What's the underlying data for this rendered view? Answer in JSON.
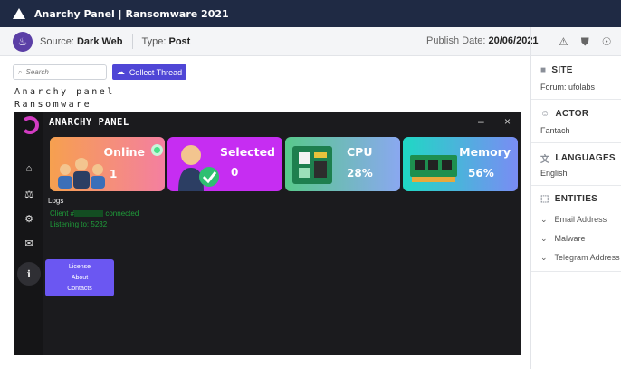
{
  "window": {
    "title": "Anarchy Panel | Ransomware 2021"
  },
  "header": {
    "source_label": "Source:",
    "source_value": "Dark Web",
    "type_label": "Type:",
    "type_value": "Post",
    "publish_label": "Publish Date:",
    "publish_value": "20/06/2021"
  },
  "toolbar": {
    "search_placeholder": "Search",
    "collect_label": "Collect Thread"
  },
  "doc": {
    "line1": "Anarchy panel",
    "line2": "Ransomware"
  },
  "panel": {
    "title": "ANARCHY PANEL",
    "minimize": "–",
    "close": "×",
    "cards": [
      {
        "title": "Online",
        "value": "1"
      },
      {
        "title": "Selected",
        "value": "0"
      },
      {
        "title": "CPU",
        "value": "28%"
      },
      {
        "title": "Memory",
        "value": "56%"
      }
    ],
    "logs_label": "Logs",
    "log_lines": [
      {
        "pre": "Client #",
        "post": "connected"
      },
      {
        "text": "Listening to: 5232"
      }
    ],
    "menu": [
      "License",
      "About",
      "Contacts"
    ]
  },
  "sidebar": {
    "site": {
      "title": "SITE",
      "value": "Forum: ufolabs"
    },
    "actor": {
      "title": "ACTOR",
      "value": "Fantach"
    },
    "languages": {
      "title": "LANGUAGES",
      "value": "English"
    },
    "entities": {
      "title": "ENTITIES",
      "items": [
        "Email Address",
        "Malware",
        "Telegram Address"
      ]
    }
  },
  "colors": {
    "titlebar": "#1f2a44",
    "accent": "#4f46d6",
    "brand": "#5b3fa6"
  }
}
